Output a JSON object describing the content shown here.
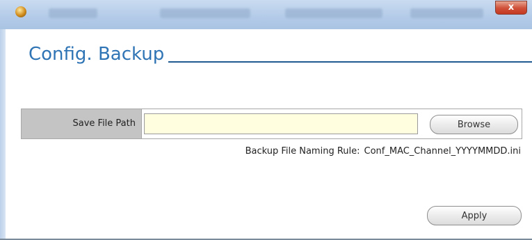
{
  "titlebar": {
    "close_glyph": "x"
  },
  "section": {
    "title": "Config. Backup"
  },
  "save_path": {
    "label": "Save File Path",
    "value": "",
    "browse_label": "Browse"
  },
  "naming_rule": {
    "label": "Backup File Naming Rule:",
    "value": "Conf_MAC_Channel_YYYYMMDD.ini"
  },
  "apply_label": "Apply",
  "colors": {
    "title_blue": "#2f74b5",
    "rule_line": "#1f5a91",
    "input_bg": "#ffffe0",
    "label_bg": "#c4c4c4"
  }
}
